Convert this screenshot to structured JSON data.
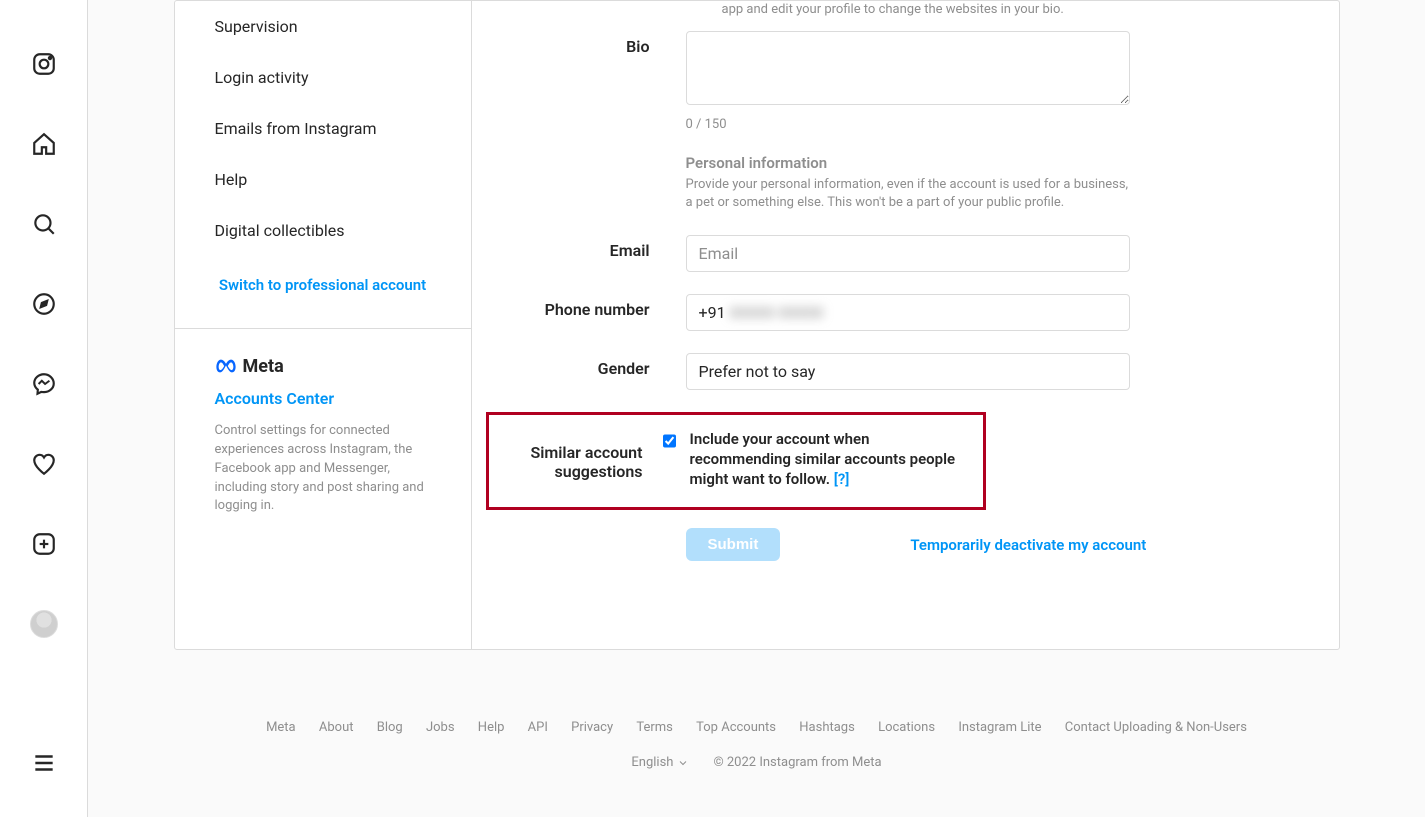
{
  "sidebar": {
    "items": [
      {
        "label": "Supervision"
      },
      {
        "label": "Login activity"
      },
      {
        "label": "Emails from Instagram"
      },
      {
        "label": "Help"
      },
      {
        "label": "Digital collectibles"
      }
    ],
    "switch_pro": "Switch to professional account"
  },
  "accounts_center": {
    "brand": "Meta",
    "title": "Accounts Center",
    "description": "Control settings for connected experiences across Instagram, the Facebook app and Messenger, including story and post sharing and logging in."
  },
  "form": {
    "website_note": "app and edit your profile to change the websites in your bio.",
    "bio_label": "Bio",
    "bio_value": "",
    "bio_count": "0 / 150",
    "personal_info_heading": "Personal information",
    "personal_info_desc": "Provide your personal information, even if the account is used for a business, a pet or something else. This won't be a part of your public profile.",
    "email_label": "Email",
    "email_placeholder": "Email",
    "email_value": "",
    "phone_label": "Phone number",
    "phone_prefix": "+91",
    "phone_hidden": "00000 00000",
    "gender_label": "Gender",
    "gender_value": "Prefer not to say",
    "similar_label_1": "Similar account",
    "similar_label_2": "suggestions",
    "similar_desc": "Include your account when recommending similar accounts people might want to follow.",
    "similar_help": "[?]",
    "submit": "Submit",
    "deactivate": "Temporarily deactivate my account"
  },
  "footer": {
    "links": [
      "Meta",
      "About",
      "Blog",
      "Jobs",
      "Help",
      "API",
      "Privacy",
      "Terms",
      "Top Accounts",
      "Hashtags",
      "Locations",
      "Instagram Lite",
      "Contact Uploading & Non-Users"
    ],
    "language": "English",
    "copyright": "© 2022 Instagram from Meta"
  }
}
